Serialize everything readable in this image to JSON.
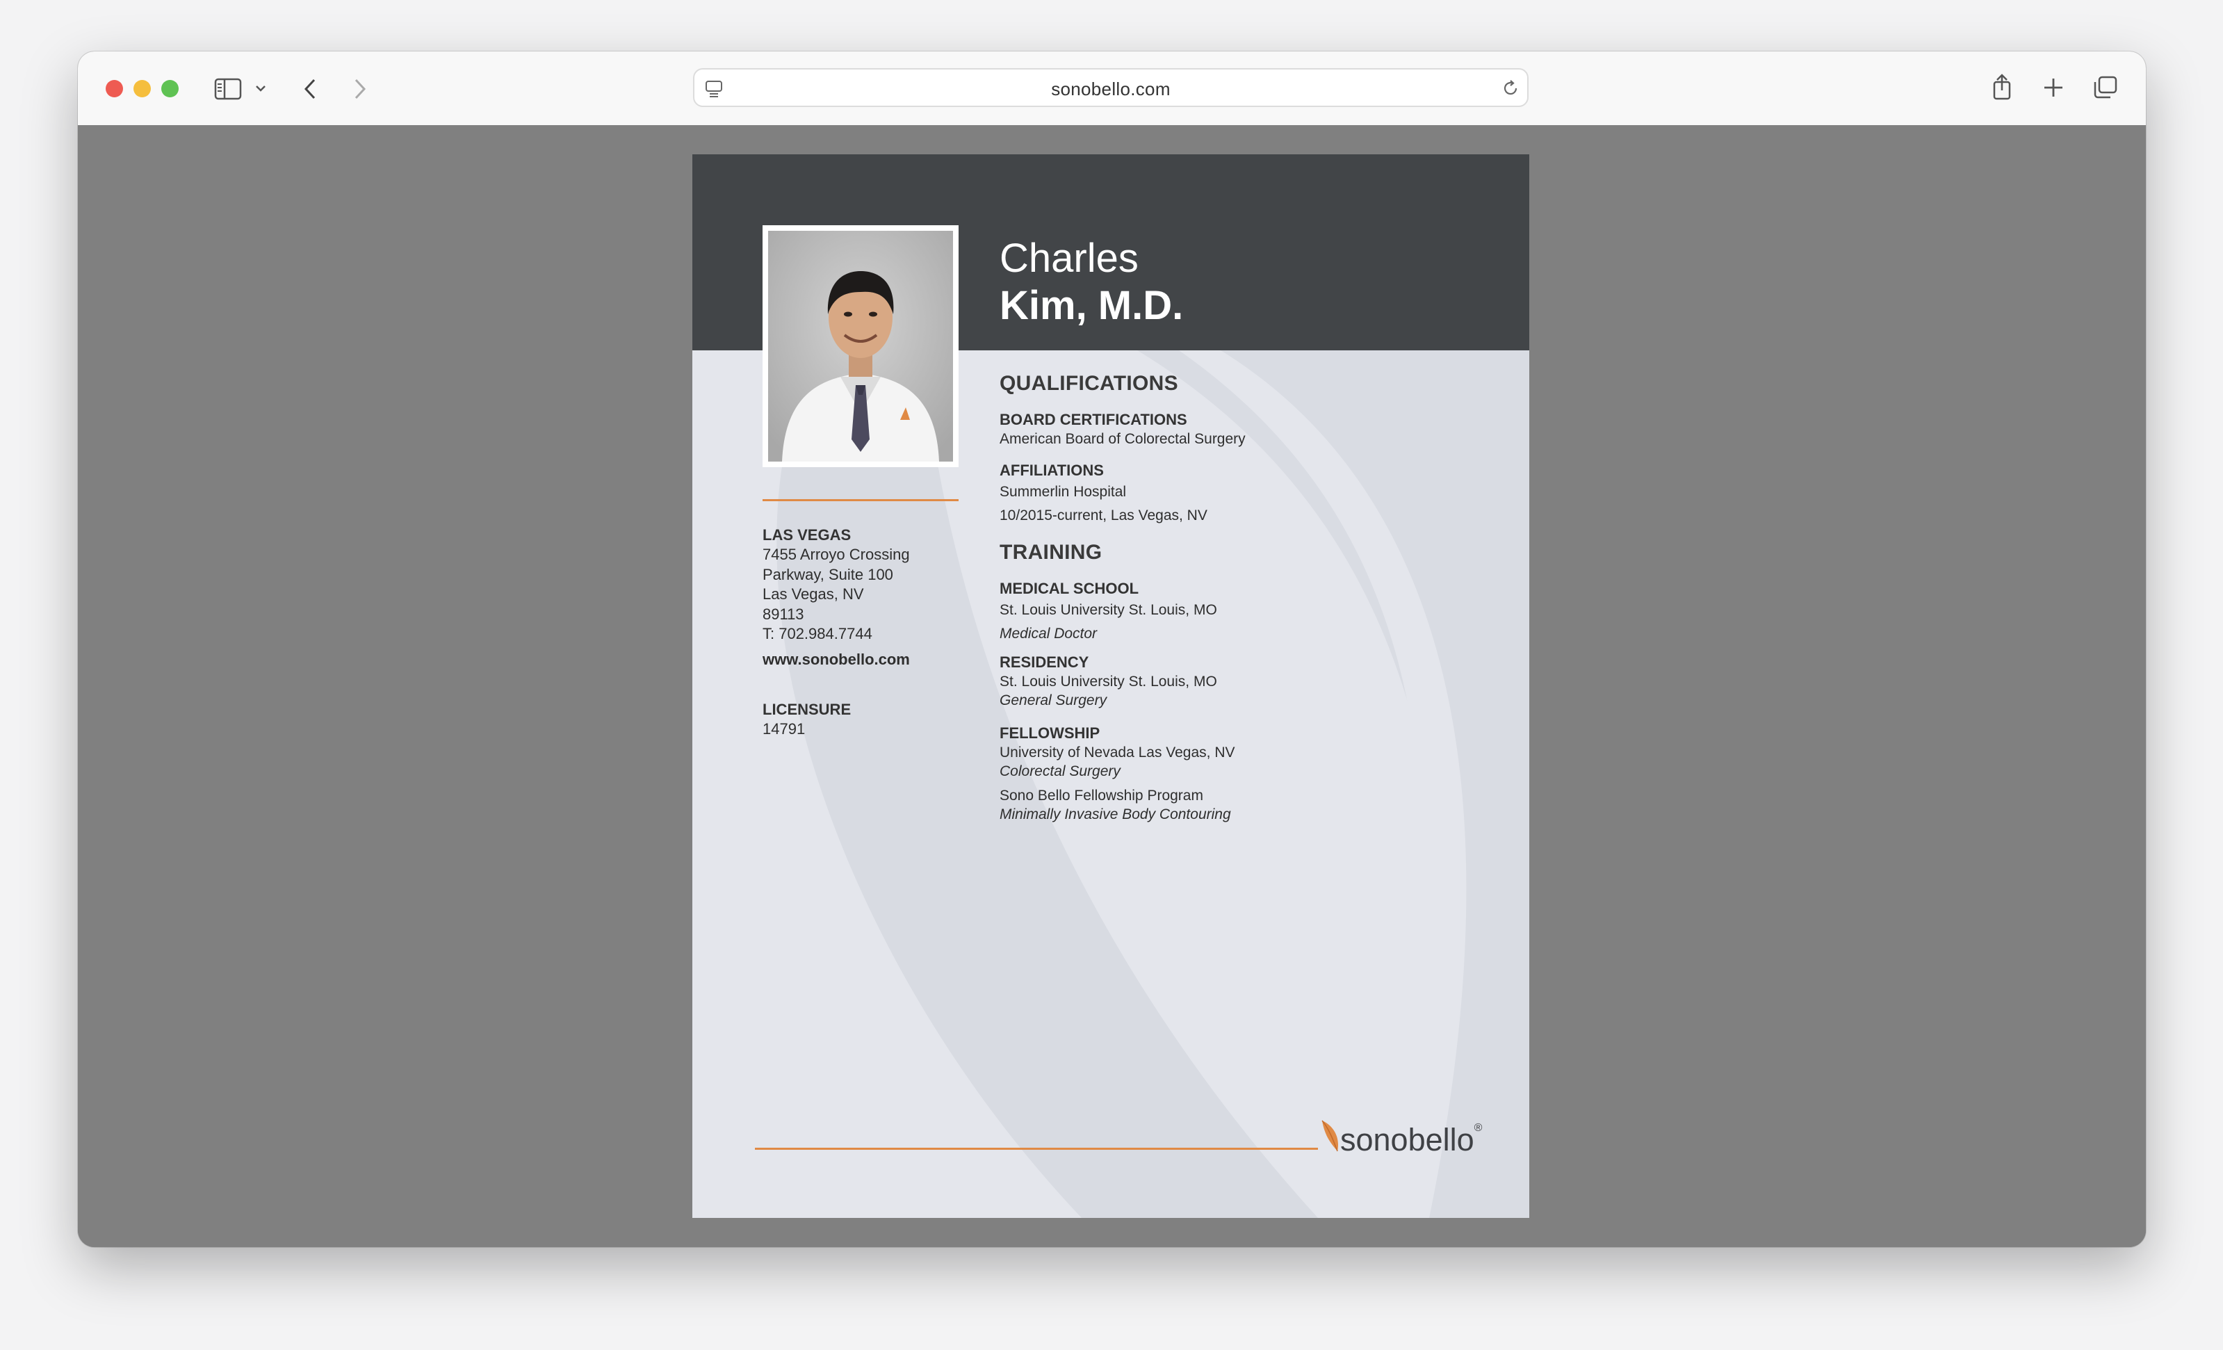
{
  "browser": {
    "url": "sonobello.com"
  },
  "doctor": {
    "first_name": "Charles",
    "last_name": "Kim, M.D."
  },
  "sidebar": {
    "location_heading": "LAS VEGAS",
    "address_lines": [
      "7455 Arroyo Crossing",
      "Parkway, Suite 100",
      "Las Vegas, NV",
      "89113",
      "T: 702.984.7744"
    ],
    "website": "www.sonobello.com",
    "licensure_heading": "LICENSURE",
    "licensure_number": "14791"
  },
  "qualifications": {
    "heading": "QUALIFICATIONS",
    "board_heading": "BOARD CERTIFICATIONS",
    "board_value": "American Board of Colorectal Surgery",
    "affiliations_heading": "AFFILIATIONS",
    "affiliations_lines": [
      "Summerlin Hospital",
      "10/2015-current, Las Vegas, NV"
    ]
  },
  "training": {
    "heading": "TRAINING",
    "medical_school_heading": "MEDICAL SCHOOL",
    "medical_school_value": "St. Louis University St. Louis, MO",
    "medical_school_degree": "Medical Doctor",
    "residency_heading": "RESIDENCY",
    "residency_value": "St. Louis University St. Louis, MO",
    "residency_specialty": "General Surgery",
    "fellowship_heading": "FELLOWSHIP",
    "fellowships": [
      {
        "place": "University of Nevada Las Vegas, NV",
        "specialty": "Colorectal Surgery"
      },
      {
        "place": "Sono Bello Fellowship Program",
        "specialty": "Minimally Invasive Body Contouring"
      }
    ]
  },
  "footer": {
    "logo_text": "sonobello"
  },
  "colors": {
    "header_band": "#424548",
    "page_background": "#e4e6ec",
    "accent_orange": "#e08a45",
    "viewport_gray": "#808080"
  }
}
